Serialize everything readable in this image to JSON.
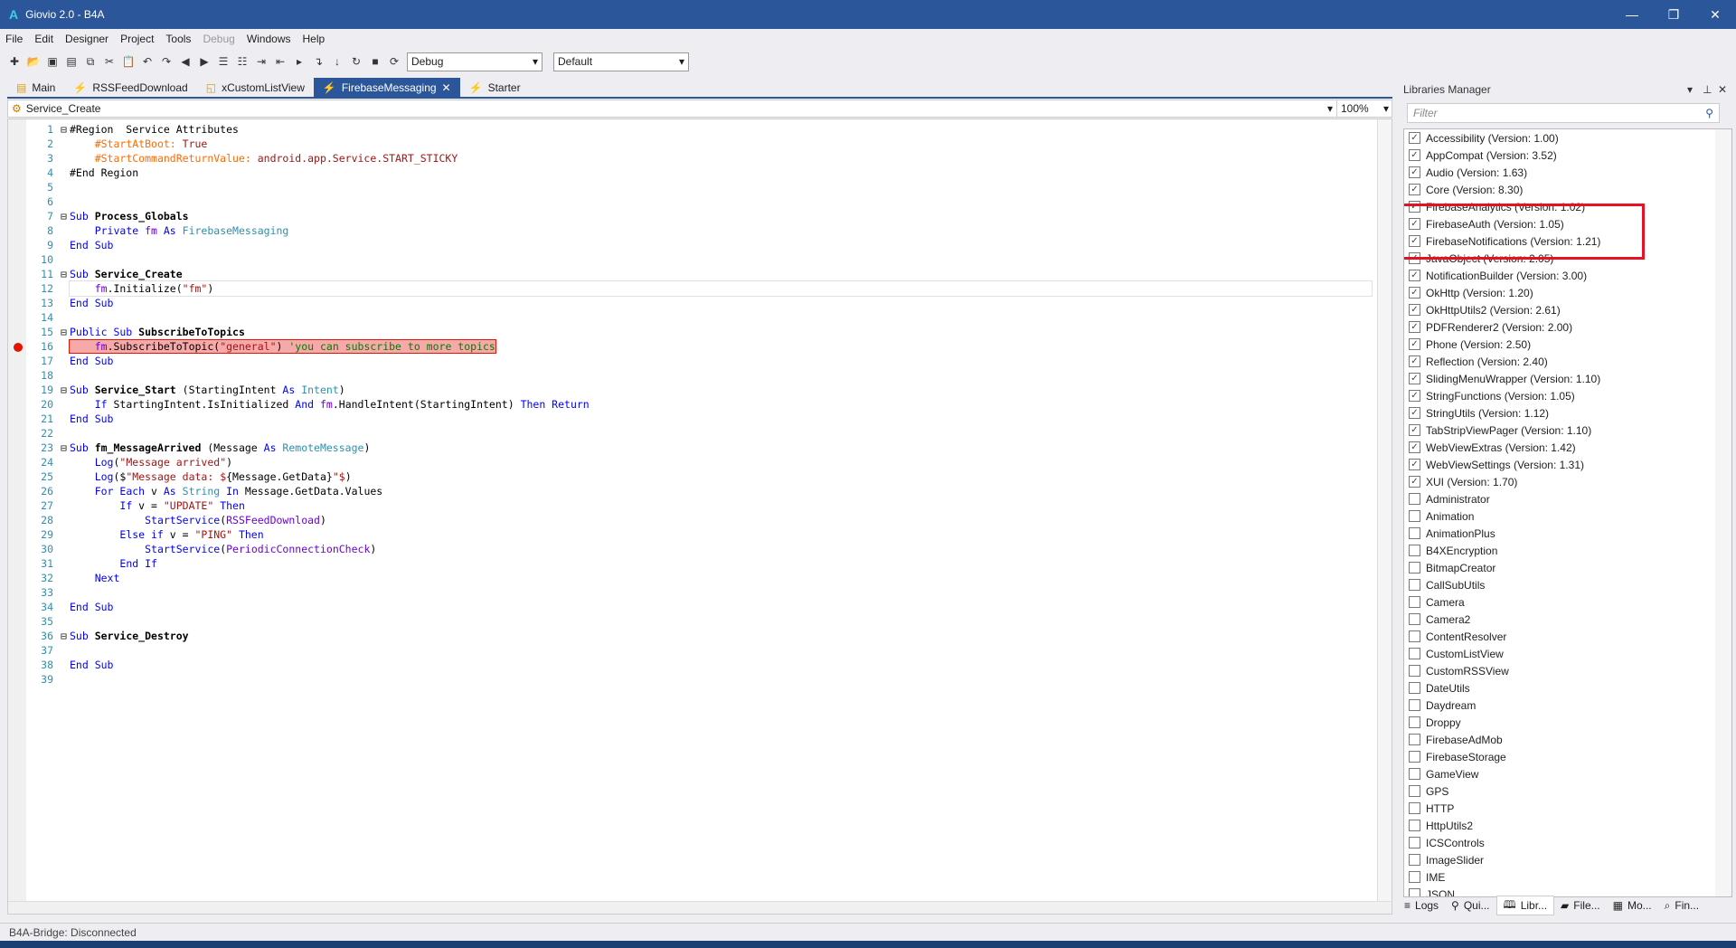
{
  "window": {
    "title": "Giovio 2.0 - B4A",
    "logo": "A",
    "minimize": "—",
    "restore": "❐",
    "close": "✕"
  },
  "menu": [
    {
      "label": "File",
      "enabled": true
    },
    {
      "label": "Edit",
      "enabled": true
    },
    {
      "label": "Designer",
      "enabled": true
    },
    {
      "label": "Project",
      "enabled": true
    },
    {
      "label": "Tools",
      "enabled": true
    },
    {
      "label": "Debug",
      "enabled": false
    },
    {
      "label": "Windows",
      "enabled": true
    },
    {
      "label": "Help",
      "enabled": true
    }
  ],
  "toolbar": {
    "icons": [
      "new-file-icon",
      "open-icon",
      "save-icon",
      "save-all-icon",
      "copy-icon",
      "cut-icon",
      "paste-icon",
      "undo-icon",
      "redo-icon",
      "back-icon",
      "forward-icon",
      "comment-icon",
      "uncomment-icon",
      "indent-icon",
      "outdent-icon",
      "run-icon",
      "step-icon",
      "step-into-icon",
      "step-over-icon",
      "stop-icon",
      "restart-icon"
    ],
    "build_mode": "Debug",
    "config": "Default"
  },
  "tabs": [
    {
      "label": "Main",
      "icon": "▤",
      "active": false
    },
    {
      "label": "RSSFeedDownload",
      "icon": "⚡",
      "active": false
    },
    {
      "label": "xCustomListView",
      "icon": "◱",
      "active": false
    },
    {
      "label": "FirebaseMessaging",
      "icon": "⚡",
      "active": true,
      "close": "✕"
    },
    {
      "label": "Starter",
      "icon": "⚡",
      "active": false
    }
  ],
  "sub_selector": "Service_Create",
  "zoom": "100%",
  "code": [
    [
      [
        "#Region  Service Attributes",
        "id"
      ]
    ],
    [
      [
        "    ",
        ""
      ],
      [
        "#StartAtBoot: ",
        "p"
      ],
      [
        "True",
        "r"
      ]
    ],
    [
      [
        "    ",
        ""
      ],
      [
        "#StartCommandReturnValue: ",
        "p"
      ],
      [
        "android.app.Service.START_STICKY",
        "r"
      ]
    ],
    [
      [
        "#End Region",
        "id"
      ]
    ],
    [],
    [],
    [
      [
        "Sub ",
        "k"
      ],
      [
        "Process_Globals",
        "n"
      ]
    ],
    [
      [
        "    ",
        ""
      ],
      [
        "Private ",
        "k"
      ],
      [
        "fm ",
        "v"
      ],
      [
        "As ",
        "k"
      ],
      [
        "FirebaseMessaging",
        "t"
      ]
    ],
    [
      [
        "End Sub",
        "k"
      ]
    ],
    [],
    [
      [
        "Sub ",
        "k"
      ],
      [
        "Service_Create",
        "n"
      ]
    ],
    [
      [
        "    ",
        ""
      ],
      [
        "fm",
        "v"
      ],
      [
        ".Initialize(",
        "id"
      ],
      [
        "\"fm\"",
        "s"
      ],
      [
        ")",
        "id"
      ]
    ],
    [
      [
        "End Sub",
        "k"
      ]
    ],
    [],
    [
      [
        "Public Sub ",
        "k"
      ],
      [
        "SubscribeToTopics",
        "n"
      ]
    ],
    [
      [
        "    ",
        ""
      ],
      [
        "fm",
        "v"
      ],
      [
        ".SubscribeToTopic(",
        "id"
      ],
      [
        "\"general\"",
        "s"
      ],
      [
        ") ",
        "id"
      ],
      [
        "'you can subscribe to more topics",
        "c"
      ]
    ],
    [
      [
        "End Sub",
        "k"
      ]
    ],
    [],
    [
      [
        "Sub ",
        "k"
      ],
      [
        "Service_Start ",
        "n"
      ],
      [
        "(StartingIntent ",
        "id"
      ],
      [
        "As ",
        "k"
      ],
      [
        "Intent",
        "t"
      ],
      [
        ")",
        "id"
      ]
    ],
    [
      [
        "    ",
        ""
      ],
      [
        "If ",
        "k"
      ],
      [
        "StartingIntent.IsInitialized ",
        "id"
      ],
      [
        "And ",
        "k"
      ],
      [
        "fm",
        "v"
      ],
      [
        ".HandleIntent(StartingIntent) ",
        "id"
      ],
      [
        "Then Return",
        "k"
      ]
    ],
    [
      [
        "End Sub",
        "k"
      ]
    ],
    [],
    [
      [
        "Sub ",
        "k"
      ],
      [
        "fm_MessageArrived ",
        "n"
      ],
      [
        "(Message ",
        "id"
      ],
      [
        "As ",
        "k"
      ],
      [
        "RemoteMessage",
        "t"
      ],
      [
        ")",
        "id"
      ]
    ],
    [
      [
        "    ",
        ""
      ],
      [
        "Log",
        "k"
      ],
      [
        "(",
        "id"
      ],
      [
        "\"Message arrived\"",
        "s"
      ],
      [
        ")",
        "id"
      ]
    ],
    [
      [
        "    ",
        ""
      ],
      [
        "Log",
        "k"
      ],
      [
        "($",
        "id"
      ],
      [
        "\"Message data: $",
        "s"
      ],
      [
        "{Message.GetData}",
        "id"
      ],
      [
        "\"$",
        "s"
      ],
      [
        ")",
        "id"
      ]
    ],
    [
      [
        "    ",
        ""
      ],
      [
        "For Each ",
        "k"
      ],
      [
        "v ",
        "id"
      ],
      [
        "As ",
        "k"
      ],
      [
        "String ",
        "t"
      ],
      [
        "In ",
        "k"
      ],
      [
        "Message.GetData.Values",
        "id"
      ]
    ],
    [
      [
        "        ",
        ""
      ],
      [
        "If ",
        "k"
      ],
      [
        "v = ",
        "id"
      ],
      [
        "\"UPDATE\" ",
        "s"
      ],
      [
        "Then",
        "k"
      ]
    ],
    [
      [
        "            ",
        ""
      ],
      [
        "StartService",
        "k"
      ],
      [
        "(",
        "id"
      ],
      [
        "RSSFeedDownload",
        "v"
      ],
      [
        ")",
        "id"
      ]
    ],
    [
      [
        "        ",
        ""
      ],
      [
        "Else if ",
        "k"
      ],
      [
        "v = ",
        "id"
      ],
      [
        "\"PING\" ",
        "s"
      ],
      [
        "Then",
        "k"
      ]
    ],
    [
      [
        "            ",
        ""
      ],
      [
        "StartService",
        "k"
      ],
      [
        "(",
        "id"
      ],
      [
        "PeriodicConnectionCheck",
        "v"
      ],
      [
        ")",
        "id"
      ]
    ],
    [
      [
        "        ",
        ""
      ],
      [
        "End If",
        "k"
      ]
    ],
    [
      [
        "    ",
        ""
      ],
      [
        "Next",
        "k"
      ]
    ],
    [],
    [
      [
        "End Sub",
        "k"
      ]
    ],
    [],
    [
      [
        "Sub ",
        "k"
      ],
      [
        "Service_Destroy",
        "n"
      ]
    ],
    [],
    [
      [
        "End Sub",
        "k"
      ]
    ],
    []
  ],
  "code_meta": {
    "breakpoint_line": 16,
    "current_line": 12,
    "fold_lines": [
      1,
      7,
      11,
      15,
      19,
      23,
      36
    ]
  },
  "libraries": {
    "title": "Libraries Manager",
    "filter_placeholder": "Filter",
    "items": [
      {
        "name": "Accessibility (Version: 1.00)",
        "checked": true
      },
      {
        "name": "AppCompat (Version: 3.52)",
        "checked": true
      },
      {
        "name": "Audio (Version: 1.63)",
        "checked": true
      },
      {
        "name": "Core (Version: 8.30)",
        "checked": true
      },
      {
        "name": "FirebaseAnalytics (Version: 1.02)",
        "checked": true
      },
      {
        "name": "FirebaseAuth (Version: 1.05)",
        "checked": true
      },
      {
        "name": "FirebaseNotifications (Version: 1.21)",
        "checked": true
      },
      {
        "name": "JavaObject (Version: 2.05)",
        "checked": true
      },
      {
        "name": "NotificationBuilder (Version: 3.00)",
        "checked": true
      },
      {
        "name": "OkHttp (Version: 1.20)",
        "checked": true
      },
      {
        "name": "OkHttpUtils2 (Version: 2.61)",
        "checked": true
      },
      {
        "name": "PDFRenderer2 (Version: 2.00)",
        "checked": true
      },
      {
        "name": "Phone (Version: 2.50)",
        "checked": true
      },
      {
        "name": "Reflection (Version: 2.40)",
        "checked": true
      },
      {
        "name": "SlidingMenuWrapper (Version: 1.10)",
        "checked": true
      },
      {
        "name": "StringFunctions (Version: 1.05)",
        "checked": true
      },
      {
        "name": "StringUtils (Version: 1.12)",
        "checked": true
      },
      {
        "name": "TabStripViewPager (Version: 1.10)",
        "checked": true
      },
      {
        "name": "WebViewExtras (Version: 1.42)",
        "checked": true
      },
      {
        "name": "WebViewSettings (Version: 1.31)",
        "checked": true
      },
      {
        "name": "XUI (Version: 1.70)",
        "checked": true
      },
      {
        "name": "Administrator",
        "checked": false
      },
      {
        "name": "Animation",
        "checked": false
      },
      {
        "name": "AnimationPlus",
        "checked": false
      },
      {
        "name": "B4XEncryption",
        "checked": false
      },
      {
        "name": "BitmapCreator",
        "checked": false
      },
      {
        "name": "CallSubUtils",
        "checked": false
      },
      {
        "name": "Camera",
        "checked": false
      },
      {
        "name": "Camera2",
        "checked": false
      },
      {
        "name": "ContentResolver",
        "checked": false
      },
      {
        "name": "CustomListView",
        "checked": false
      },
      {
        "name": "CustomRSSView",
        "checked": false
      },
      {
        "name": "DateUtils",
        "checked": false
      },
      {
        "name": "Daydream",
        "checked": false
      },
      {
        "name": "Droppy",
        "checked": false
      },
      {
        "name": "FirebaseAdMob",
        "checked": false
      },
      {
        "name": "FirebaseStorage",
        "checked": false
      },
      {
        "name": "GameView",
        "checked": false
      },
      {
        "name": "GPS",
        "checked": false
      },
      {
        "name": "HTTP",
        "checked": false
      },
      {
        "name": "HttpUtils2",
        "checked": false
      },
      {
        "name": "ICSControls",
        "checked": false
      },
      {
        "name": "ImageSlider",
        "checked": false
      },
      {
        "name": "IME",
        "checked": false
      },
      {
        "name": "JSON",
        "checked": false
      }
    ]
  },
  "bottom_tabs": [
    {
      "label": "Logs",
      "icon": "≡"
    },
    {
      "label": "Qui...",
      "icon": "⚲"
    },
    {
      "label": "Libr...",
      "icon": "🕮",
      "active": true
    },
    {
      "label": "File...",
      "icon": "▰"
    },
    {
      "label": "Mo...",
      "icon": "▦"
    },
    {
      "label": "Fin...",
      "icon": "⌕"
    }
  ],
  "status": "B4A-Bridge: Disconnected",
  "colors": {
    "accent": "#2b579a",
    "breakpoint": "#e51400",
    "highlight_box": "#e81123"
  }
}
